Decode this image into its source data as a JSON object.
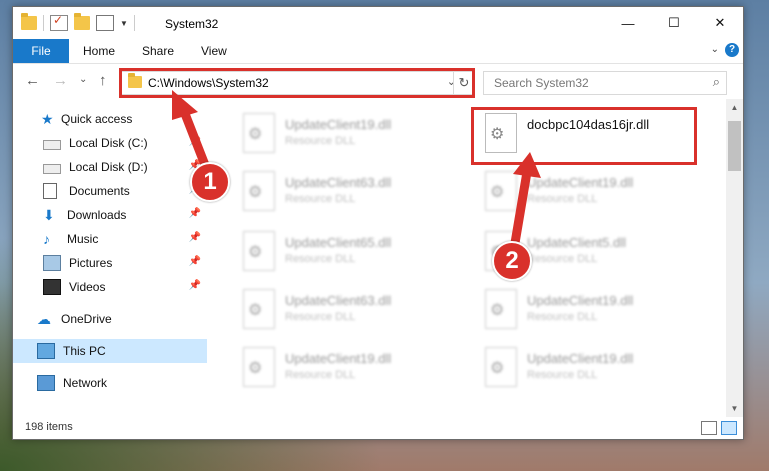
{
  "window": {
    "title": "System32",
    "minimize": "—",
    "maximize": "☐",
    "close": "✕"
  },
  "ribbon": {
    "tabs": [
      "File",
      "Home",
      "Share",
      "View"
    ],
    "help": "?"
  },
  "nav": {
    "back": "←",
    "forward": "→",
    "recent": "⌄",
    "up": "↑",
    "address": "C:\\Windows\\System32",
    "address_dropdown": "⌄",
    "refresh": "↻",
    "search_placeholder": "Search System32",
    "search_icon": "⌕"
  },
  "sidebar": {
    "items": [
      {
        "label": "Quick access",
        "icon": "star-icon",
        "pinned": false
      },
      {
        "label": "Local Disk (C:)",
        "icon": "drive-icon",
        "pinned": true
      },
      {
        "label": "Local Disk (D:)",
        "icon": "drive-icon",
        "pinned": true
      },
      {
        "label": "Documents",
        "icon": "document-icon",
        "pinned": true
      },
      {
        "label": "Downloads",
        "icon": "download-icon",
        "pinned": true
      },
      {
        "label": "Music",
        "icon": "music-icon",
        "pinned": true
      },
      {
        "label": "Pictures",
        "icon": "pictures-icon",
        "pinned": true
      },
      {
        "label": "Videos",
        "icon": "video-icon",
        "pinned": true
      },
      {
        "label": "OneDrive",
        "icon": "cloud-icon",
        "pinned": false
      },
      {
        "label": "This PC",
        "icon": "computer-icon",
        "pinned": false,
        "selected": true
      },
      {
        "label": "Network",
        "icon": "network-icon",
        "pinned": false
      }
    ]
  },
  "files": {
    "left_column": [
      {
        "name": "UpdateClient19.dll",
        "type": "Resource DLL"
      },
      {
        "name": "UpdateClient63.dll",
        "type": "Resource DLL"
      },
      {
        "name": "UpdateClient65.dll",
        "type": "Resource DLL"
      },
      {
        "name": "UpdateClient63.dll",
        "type": "Resource DLL"
      },
      {
        "name": "UpdateClient19.dll",
        "type": "Resource DLL"
      }
    ],
    "right_column": [
      {
        "name": "docbpc104das16jr.dll",
        "type": ""
      },
      {
        "name": "UpdateClient19.dll",
        "type": "Resource DLL"
      },
      {
        "name": "UpdateClient5.dll",
        "type": "Resource DLL"
      },
      {
        "name": "UpdateClient19.dll",
        "type": "Resource DLL"
      },
      {
        "name": "UpdateClient19.dll",
        "type": "Resource DLL"
      }
    ]
  },
  "status": {
    "item_count": "198 items"
  },
  "annotations": {
    "step1": "1",
    "step2": "2",
    "color": "#d9312b"
  }
}
